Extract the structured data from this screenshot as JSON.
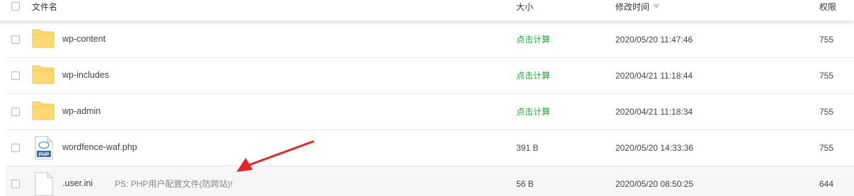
{
  "header": {
    "name": "文件名",
    "size": "大小",
    "mtime": "修改时间",
    "perm": "权限"
  },
  "rows": [
    {
      "name": "wp-content",
      "size": "点击计算",
      "mtime": "2020/05/20 11:47:46",
      "perm": "755",
      "icon": "folder-icon"
    },
    {
      "name": "wp-includes",
      "size": "点击计算",
      "mtime": "2020/04/21 11:18:44",
      "perm": "755",
      "icon": "folder-icon"
    },
    {
      "name": "wp-admin",
      "size": "点击计算",
      "mtime": "2020/04/21 11:18:34",
      "perm": "755",
      "icon": "folder-icon"
    },
    {
      "name": "wordfence-waf.php",
      "size": "391 B",
      "mtime": "2020/05/20 14:33:36",
      "perm": "755",
      "icon": "php-file-icon"
    },
    {
      "name": ".user.ini",
      "note": "PS: PHP用户配置文件(防跨站)!",
      "size": "56 B",
      "mtime": "2020/05/20 08:50:25",
      "perm": "644",
      "icon": "file-icon"
    }
  ],
  "php_badge": "PHP",
  "colors": {
    "calc_link": "#20a53a",
    "folder": "#fcd975",
    "arrow": "#e8262a",
    "highlight_row": "#f6f6f6"
  }
}
